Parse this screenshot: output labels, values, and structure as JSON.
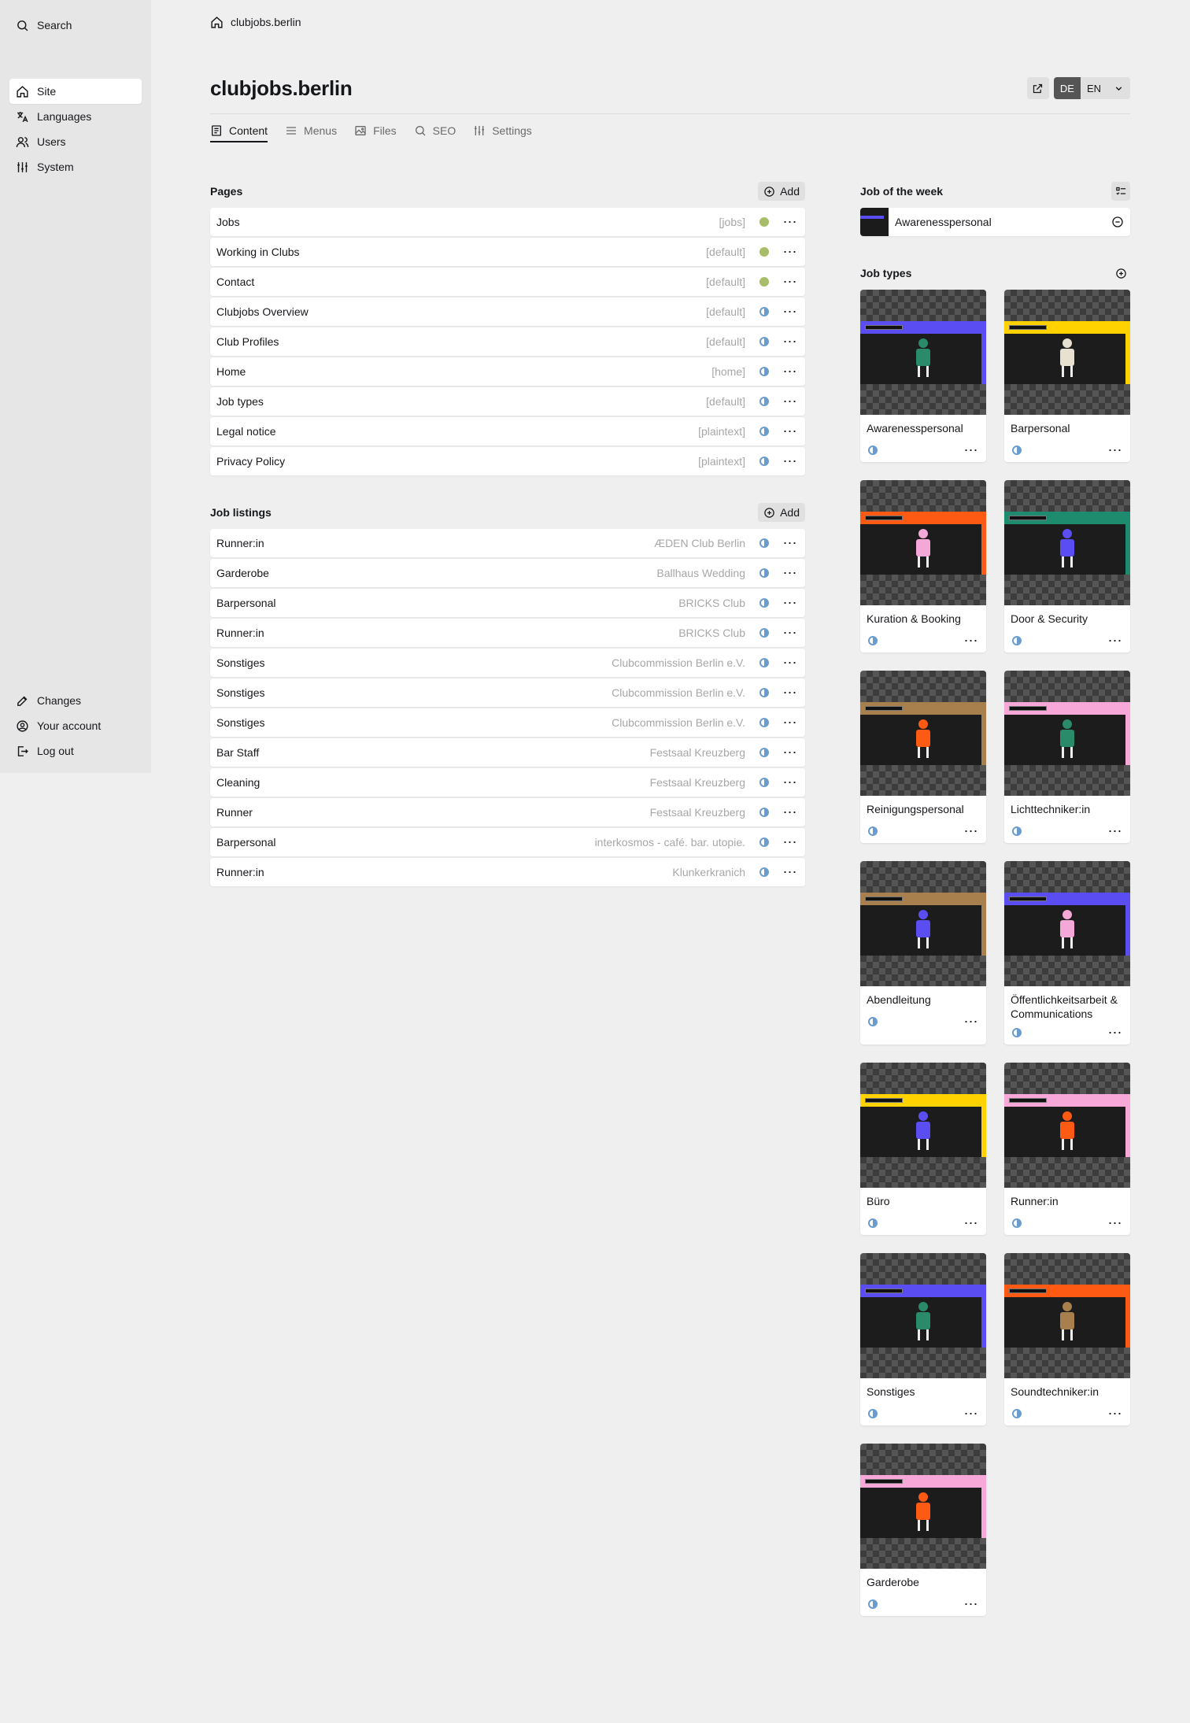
{
  "sidebar": {
    "search_label": "Search",
    "items": [
      {
        "label": "Site",
        "icon": "home-icon",
        "active": true
      },
      {
        "label": "Languages",
        "icon": "translate-icon",
        "active": false
      },
      {
        "label": "Users",
        "icon": "users-icon",
        "active": false
      },
      {
        "label": "System",
        "icon": "sliders-icon",
        "active": false
      }
    ],
    "bottom": [
      {
        "label": "Changes",
        "icon": "edit-icon"
      },
      {
        "label": "Your account",
        "icon": "account-icon"
      },
      {
        "label": "Log out",
        "icon": "logout-icon"
      }
    ]
  },
  "breadcrumb": {
    "label": "clubjobs.berlin"
  },
  "header": {
    "title": "clubjobs.berlin",
    "languages": [
      "DE",
      "EN"
    ],
    "active_language": "DE"
  },
  "tabs": [
    {
      "label": "Content",
      "active": true
    },
    {
      "label": "Menus",
      "active": false
    },
    {
      "label": "Files",
      "active": false
    },
    {
      "label": "SEO",
      "active": false
    },
    {
      "label": "Settings",
      "active": false
    }
  ],
  "pages": {
    "title": "Pages",
    "add_label": "Add",
    "items": [
      {
        "title": "Jobs",
        "info": "[jobs]",
        "status": "listed"
      },
      {
        "title": "Working in Clubs",
        "info": "[default]",
        "status": "listed"
      },
      {
        "title": "Contact",
        "info": "[default]",
        "status": "listed"
      },
      {
        "title": "Clubjobs Overview",
        "info": "[default]",
        "status": "unlisted"
      },
      {
        "title": "Club Profiles",
        "info": "[default]",
        "status": "unlisted"
      },
      {
        "title": "Home",
        "info": "[home]",
        "status": "unlisted"
      },
      {
        "title": "Job types",
        "info": "[default]",
        "status": "unlisted"
      },
      {
        "title": "Legal notice",
        "info": "[plaintext]",
        "status": "unlisted"
      },
      {
        "title": "Privacy Policy",
        "info": "[plaintext]",
        "status": "unlisted"
      }
    ]
  },
  "listings": {
    "title": "Job listings",
    "add_label": "Add",
    "items": [
      {
        "title": "Runner:in",
        "info": "ÆDEN Club Berlin"
      },
      {
        "title": "Garderobe",
        "info": "Ballhaus Wedding"
      },
      {
        "title": "Barpersonal",
        "info": "BRICKS Club"
      },
      {
        "title": "Runner:in",
        "info": "BRICKS Club"
      },
      {
        "title": "Sonstiges",
        "info": "Clubcommission Berlin e.V."
      },
      {
        "title": "Sonstiges",
        "info": "Clubcommission Berlin e.V."
      },
      {
        "title": "Sonstiges",
        "info": "Clubcommission Berlin e.V."
      },
      {
        "title": "Bar Staff",
        "info": "Festsaal Kreuzberg"
      },
      {
        "title": "Cleaning",
        "info": "Festsaal Kreuzberg"
      },
      {
        "title": "Runner",
        "info": "Festsaal Kreuzberg"
      },
      {
        "title": "Barpersonal",
        "info": "interkosmos - café. bar. utopie."
      },
      {
        "title": "Runner:in",
        "info": "Klunkerkranich"
      }
    ]
  },
  "job_of_week": {
    "title": "Job of the week",
    "name": "Awarenesspersonal"
  },
  "job_types": {
    "title": "Job types",
    "items": [
      {
        "label": "Awarenesspersonal",
        "color": "#5a4ef2",
        "fig": "#2a8b6a"
      },
      {
        "label": "Barpersonal",
        "color": "#ffd200",
        "fig": "#e8e0d0"
      },
      {
        "label": "Kuration & Booking",
        "color": "#ff5a14",
        "fig": "#f4a8d8"
      },
      {
        "label": "Door & Security",
        "color": "#1e8a6e",
        "fig": "#5a4ef2"
      },
      {
        "label": "Reinigungspersonal",
        "color": "#a8804e",
        "fig": "#ff5a14"
      },
      {
        "label": "Lichttechniker:in",
        "color": "#f7a8d8",
        "fig": "#2a8b6a"
      },
      {
        "label": "Abendleitung",
        "color": "#a8804e",
        "fig": "#5a4ef2"
      },
      {
        "label": "Öffentlichkeitsarbeit & Communications",
        "color": "#5a4ef2",
        "fig": "#f4a8d8"
      },
      {
        "label": "Büro",
        "color": "#ffd200",
        "fig": "#5a4ef2"
      },
      {
        "label": "Runner:in",
        "color": "#f7a8d8",
        "fig": "#ff5a14"
      },
      {
        "label": "Sonstiges",
        "color": "#5a4ef2",
        "fig": "#2a8b6a"
      },
      {
        "label": "Soundtechniker:in",
        "color": "#ff5a14",
        "fig": "#a8804e"
      },
      {
        "label": "Garderobe",
        "color": "#f7a8d8",
        "fig": "#ff5a14"
      }
    ]
  }
}
